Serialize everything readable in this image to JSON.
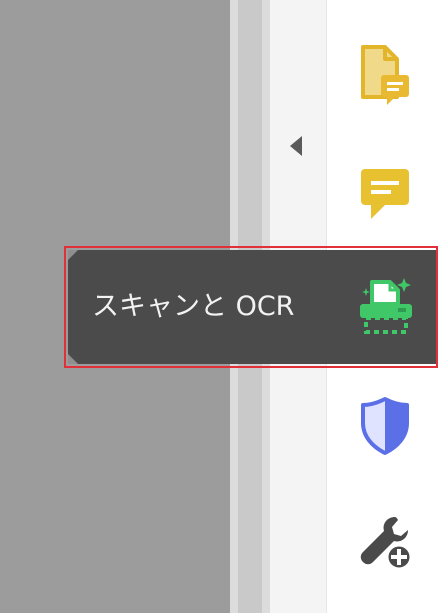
{
  "tooltip": {
    "label": "スキャンと OCR"
  },
  "tools": [
    {
      "icon": "document-comment-icon",
      "color": "#e8b931"
    },
    {
      "icon": "comment-icon",
      "color": "#e8b931"
    },
    {
      "icon": "scan-ocr-icon",
      "color": "#3fc768"
    },
    {
      "icon": "shield-icon",
      "color": "#5b6fe6"
    },
    {
      "icon": "wrench-add-icon",
      "color": "#4a4a4a"
    }
  ],
  "colors": {
    "highlight_border": "#e0303a",
    "tooltip_bg": "#4b4b4b",
    "document_bg": "#9c9c9c"
  }
}
